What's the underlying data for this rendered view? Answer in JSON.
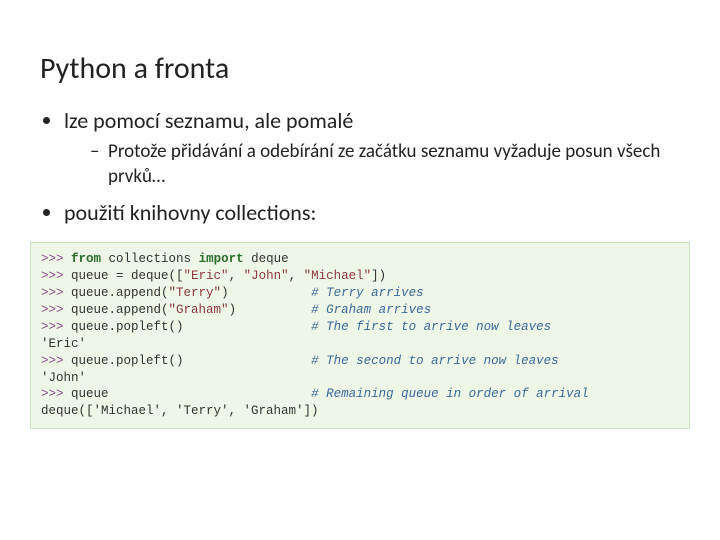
{
  "title": "Python a fronta",
  "bullets": {
    "b1": "lze pomocí seznamu, ale pomalé",
    "b1_sub": "Protože přidávání a odebírání ze začátku seznamu vyžaduje posun všech prvků…",
    "b2": "použití knihovny collections:"
  },
  "code": {
    "p": ">>>",
    "from": "from",
    "module": " collections ",
    "import": "import",
    "deque": " deque",
    "l2a": " queue = deque([",
    "l2s1": "\"Eric\"",
    "l2c1": ", ",
    "l2s2": "\"John\"",
    "l2c2": ", ",
    "l2s3": "\"Michael\"",
    "l2b": "])",
    "l3a": " queue.append(",
    "l3s": "\"Terry\"",
    "l3b": ")           ",
    "l3c": "# Terry arrives",
    "l4a": " queue.append(",
    "l4s": "\"Graham\"",
    "l4b": ")          ",
    "l4c": "# Graham arrives",
    "l5a": " queue.popleft()                 ",
    "l5c": "# The first to arrive now leaves",
    "l6": "'Eric'",
    "l7a": " queue.popleft()                 ",
    "l7c": "# The second to arrive now leaves",
    "l8": "'John'",
    "l9a": " queue                           ",
    "l9c": "# Remaining queue in order of arrival",
    "l10": "deque(['Michael', 'Terry', 'Graham'])"
  }
}
